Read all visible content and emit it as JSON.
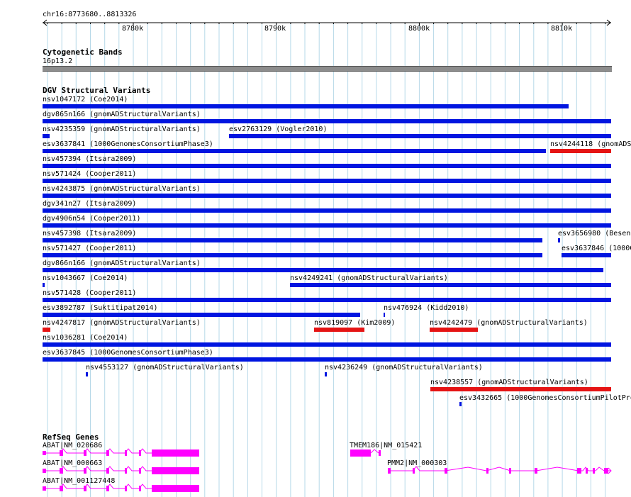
{
  "ruler": {
    "location": "chr16:8773680..8813326",
    "ticks": [
      "8780k",
      "8790k",
      "8800k",
      "8810k"
    ]
  },
  "colors": {
    "gain": "#0015e0",
    "loss": "#e51414",
    "gene": "#ff00ff",
    "grid": "#b6d8e8",
    "band": "#8c8c8c"
  },
  "tracks": {
    "cytoband": {
      "title": "Cytogenetic Bands",
      "band_label": "16p13.2"
    },
    "dgv": {
      "title": "DGV Structural Variants",
      "features": [
        {
          "label": "nsv1047172 (Coe2014)",
          "type": "gain"
        },
        {
          "label": "dgv865n166 (gnomADStructuralVariants)",
          "type": "gain"
        },
        {
          "label": "nsv4235359 (gnomADStructuralVariants)",
          "type": "gain"
        },
        {
          "label": "esv2763129 (Vogler2010)",
          "type": "gain"
        },
        {
          "label": "esv3637841 (1000GenomesConsortiumPhase3)",
          "type": "gain"
        },
        {
          "label": "nsv4244118 (gnomADS",
          "type": "loss"
        },
        {
          "label": "nsv457394 (Itsara2009)",
          "type": "gain"
        },
        {
          "label": "nsv571424 (Cooper2011)",
          "type": "gain"
        },
        {
          "label": "nsv4243875 (gnomADStructuralVariants)",
          "type": "gain"
        },
        {
          "label": "dgv341n27 (Itsara2009)",
          "type": "gain"
        },
        {
          "label": "dgv4906n54 (Cooper2011)",
          "type": "gain"
        },
        {
          "label": "nsv457398 (Itsara2009)",
          "type": "gain"
        },
        {
          "label": "esv3656980 (Besenb",
          "type": "gain"
        },
        {
          "label": "nsv571427 (Cooper2011)",
          "type": "gain"
        },
        {
          "label": "esv3637846 (1000G",
          "type": "gain"
        },
        {
          "label": "dgv866n166 (gnomADStructuralVariants)",
          "type": "gain"
        },
        {
          "label": "nsv1043667 (Coe2014)",
          "type": "gain"
        },
        {
          "label": "nsv4249241 (gnomADStructuralVariants)",
          "type": "gain"
        },
        {
          "label": "nsv571428 (Cooper2011)",
          "type": "gain"
        },
        {
          "label": "esv3892787 (Suktitipat2014)",
          "type": "gain"
        },
        {
          "label": "nsv476924 (Kidd2010)",
          "type": "gain"
        },
        {
          "label": "nsv4247817 (gnomADStructuralVariants)",
          "type": "loss"
        },
        {
          "label": "nsv819097 (Kim2009)",
          "type": "loss"
        },
        {
          "label": "nsv4242479 (gnomADStructuralVariants)",
          "type": "loss"
        },
        {
          "label": "nsv1036281 (Coe2014)",
          "type": "gain"
        },
        {
          "label": "esv3637845 (1000GenomesConsortiumPhase3)",
          "type": "gain"
        },
        {
          "label": "nsv4553127 (gnomADStructuralVariants)",
          "type": "gain"
        },
        {
          "label": "nsv4236249 (gnomADStructuralVariants)",
          "type": "gain"
        },
        {
          "label": "nsv4238557 (gnomADStructuralVariants)",
          "type": "loss"
        },
        {
          "label": "esv3432665 (1000GenomesConsortiumPilotPro",
          "type": "gain"
        }
      ]
    },
    "refseq": {
      "title": "RefSeq Genes",
      "genes": [
        {
          "label": "ABAT|NM_020686"
        },
        {
          "label": "TMEM186|NM_015421"
        },
        {
          "label": "ABAT|NM_000663"
        },
        {
          "label": "PMM2|NM_000303"
        },
        {
          "label": "ABAT|NM_001127448"
        }
      ]
    }
  }
}
